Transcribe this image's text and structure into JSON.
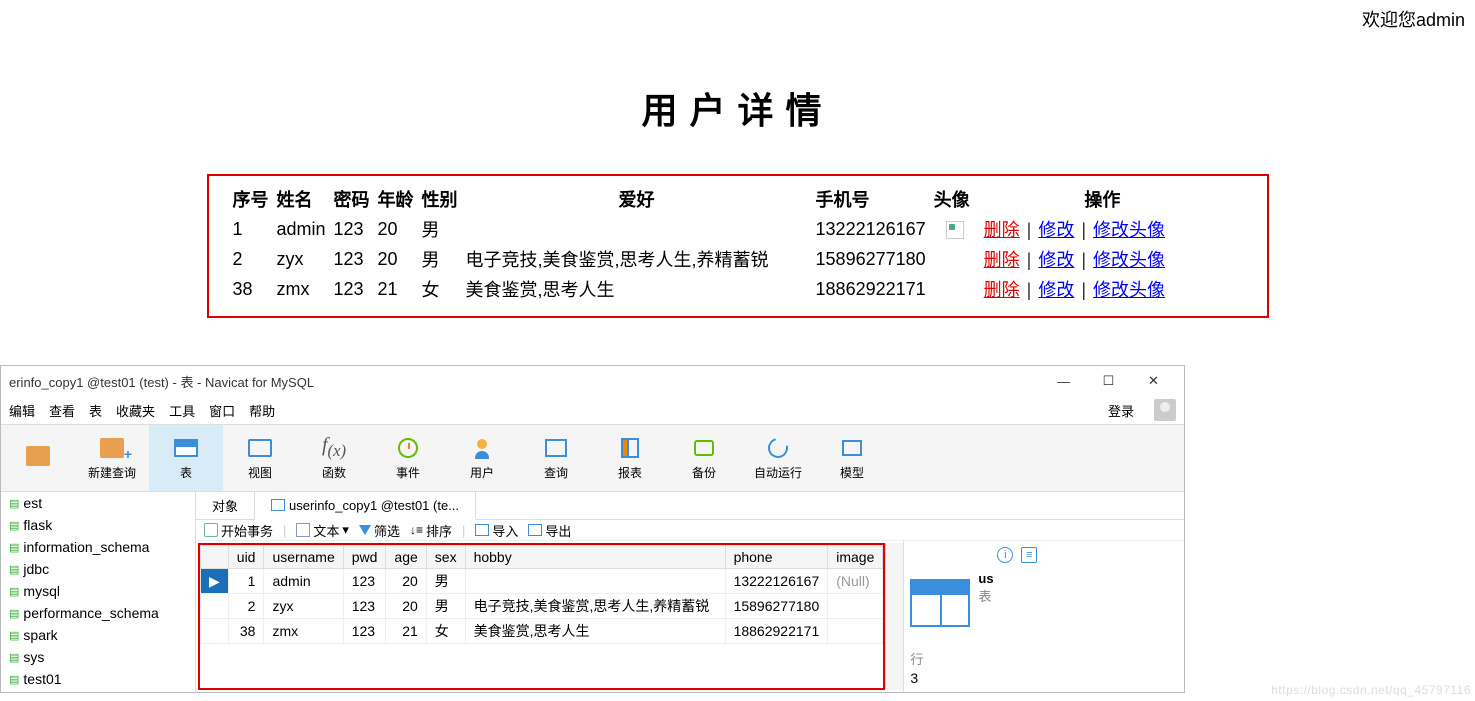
{
  "web": {
    "welcome": "欢迎您admin",
    "title": "用户详情",
    "headers": {
      "id": "序号",
      "name": "姓名",
      "pwd": "密码",
      "age": "年龄",
      "sex": "性别",
      "hobby": "爱好",
      "phone": "手机号",
      "avatar": "头像",
      "ops": "操作"
    },
    "ops": {
      "del": "删除",
      "edit": "修改",
      "avatar": "修改头像",
      "sep": " | "
    },
    "rows": [
      {
        "id": "1",
        "name": "admin",
        "pwd": "123",
        "age": "20",
        "sex": "男",
        "hobby": "",
        "phone": "13222126167",
        "has_img": true
      },
      {
        "id": "2",
        "name": "zyx",
        "pwd": "123",
        "age": "20",
        "sex": "男",
        "hobby": "电子竞技,美食鉴赏,思考人生,养精蓄锐",
        "phone": "15896277180",
        "has_img": false
      },
      {
        "id": "38",
        "name": "zmx",
        "pwd": "123",
        "age": "21",
        "sex": "女",
        "hobby": "美食鉴赏,思考人生",
        "phone": "18862922171",
        "has_img": false
      }
    ]
  },
  "navicat": {
    "title": "erinfo_copy1 @test01 (test) - 表 - Navicat for MySQL",
    "menus": [
      "编辑",
      "查看",
      "表",
      "收藏夹",
      "工具",
      "窗口",
      "帮助"
    ],
    "login": "登录",
    "tools": [
      {
        "label": "",
        "icon": "conn"
      },
      {
        "label": "新建查询",
        "icon": "newconn"
      },
      {
        "label": "表",
        "icon": "table",
        "active": true
      },
      {
        "label": "视图",
        "icon": "view"
      },
      {
        "label": "函数",
        "icon": "fx"
      },
      {
        "label": "事件",
        "icon": "clock"
      },
      {
        "label": "用户",
        "icon": "user"
      },
      {
        "label": "查询",
        "icon": "query"
      },
      {
        "label": "报表",
        "icon": "report"
      },
      {
        "label": "备份",
        "icon": "backup"
      },
      {
        "label": "自动运行",
        "icon": "auto"
      },
      {
        "label": "模型",
        "icon": "model"
      }
    ],
    "sidebar": [
      "est",
      "flask",
      "information_schema",
      "jdbc",
      "mysql",
      "performance_schema",
      "spark",
      "sys",
      "test01"
    ],
    "tabs": {
      "objects": "对象",
      "active": "userinfo_copy1 @test01 (te..."
    },
    "subtool": {
      "begin": "开始事务",
      "text": "文本",
      "filter": "筛选",
      "sort": "排序",
      "import": "导入",
      "export": "导出"
    },
    "grid": {
      "headers": [
        "uid",
        "username",
        "pwd",
        "age",
        "sex",
        "hobby",
        "phone",
        "image"
      ],
      "rows": [
        {
          "uid": "1",
          "username": "admin",
          "pwd": "123",
          "age": "20",
          "sex": "男",
          "hobby": "",
          "phone": "13222126167",
          "image": "(Null)",
          "selected": true
        },
        {
          "uid": "2",
          "username": "zyx",
          "pwd": "123",
          "age": "20",
          "sex": "男",
          "hobby": "电子竞技,美食鉴赏,思考人生,养精蓄锐",
          "phone": "15896277180",
          "image": ""
        },
        {
          "uid": "38",
          "username": "zmx",
          "pwd": "123",
          "age": "21",
          "sex": "女",
          "hobby": "美食鉴赏,思考人生",
          "phone": "18862922171",
          "image": ""
        }
      ]
    },
    "rightpane": {
      "us": "us",
      "table": "表",
      "rows_label": "行",
      "rows_count": "3"
    }
  },
  "watermark": "https://blog.csdn.net/qq_45797116"
}
